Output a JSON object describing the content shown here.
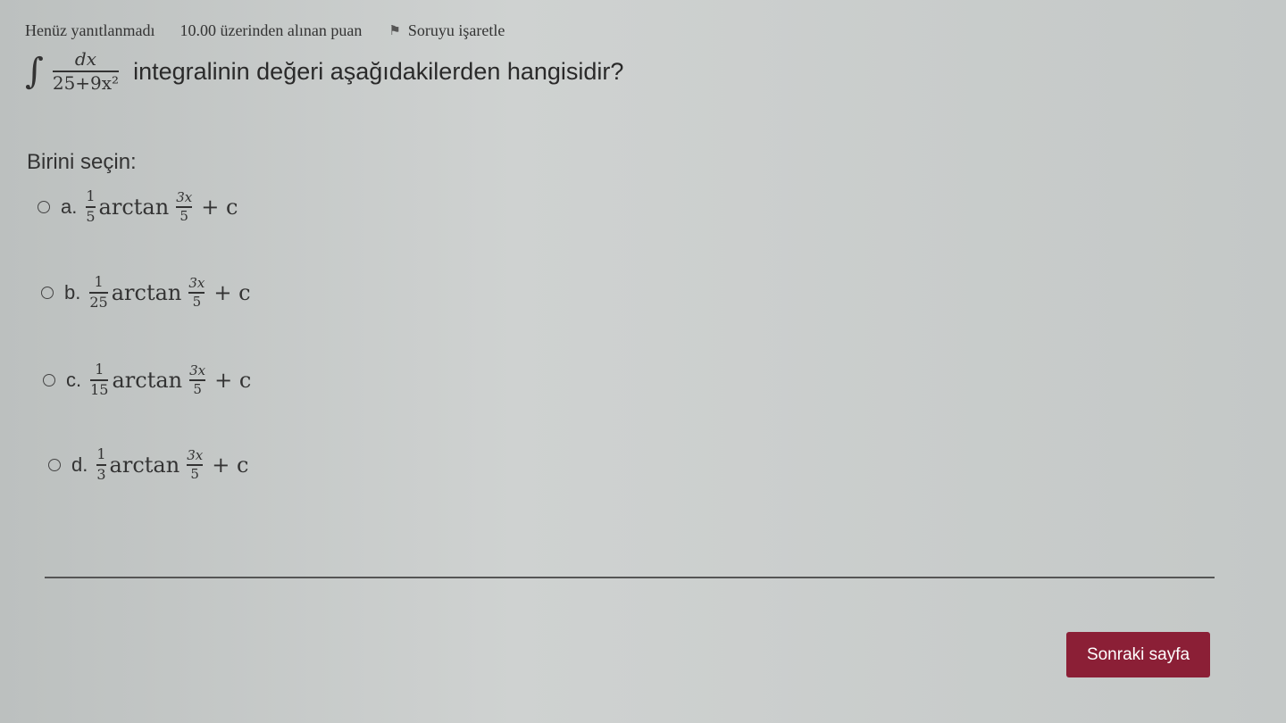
{
  "info": {
    "state": "Henüz yanıtlanmadı",
    "grade": "10.00 üzerinden alınan puan",
    "flag_label": "Soruyu işaretle"
  },
  "question": {
    "integral_sign": "∫",
    "numerator": "dx",
    "denominator": "25+9x²",
    "text": "integralinin değeri aşağıdakilerden hangisidir?"
  },
  "prompt": "Birini seçin:",
  "options": [
    {
      "letter": "a.",
      "coef_num": "1",
      "coef_den": "5",
      "func": "arctan",
      "arg_num": "3x",
      "arg_den": "5",
      "tail": "+ c"
    },
    {
      "letter": "b.",
      "coef_num": "1",
      "coef_den": "25",
      "func": "arctan",
      "arg_num": "3x",
      "arg_den": "5",
      "tail": "+ c"
    },
    {
      "letter": "c.",
      "coef_num": "1",
      "coef_den": "15",
      "func": "arctan",
      "arg_num": "3x",
      "arg_den": "5",
      "tail": "+ c"
    },
    {
      "letter": "d.",
      "coef_num": "1",
      "coef_den": "3",
      "func": "arctan",
      "arg_num": "3x",
      "arg_den": "5",
      "tail": "+ c"
    }
  ],
  "next_button": "Sonraki sayfa"
}
